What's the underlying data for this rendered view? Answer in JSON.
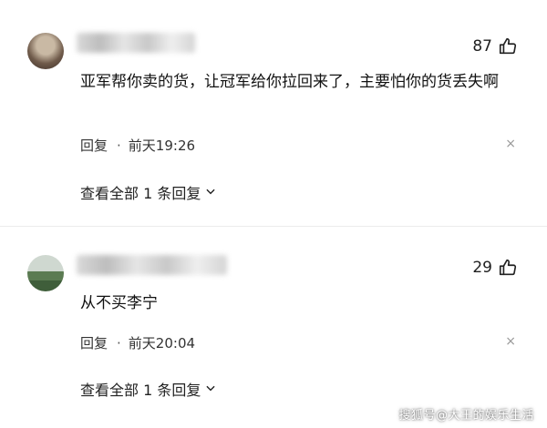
{
  "comments": [
    {
      "likes": "87",
      "text": "亚军帮你卖的货，让冠军给你拉回来了，主要怕你的货丢失啊",
      "reply_label": "回复",
      "time": "前天19:26",
      "view_all": "查看全部 1 条回复"
    },
    {
      "likes": "29",
      "text": "从不买李宁",
      "reply_label": "回复",
      "time": "前天20:04",
      "view_all": "查看全部 1 条回复"
    }
  ],
  "icons": {
    "like": "thumbs-up-icon",
    "close": "close-icon",
    "expand": "chevron-down-icon"
  },
  "close_glyph": "×",
  "dot_glyph": "·",
  "watermark": "搜狐号@大王的娱乐生活"
}
